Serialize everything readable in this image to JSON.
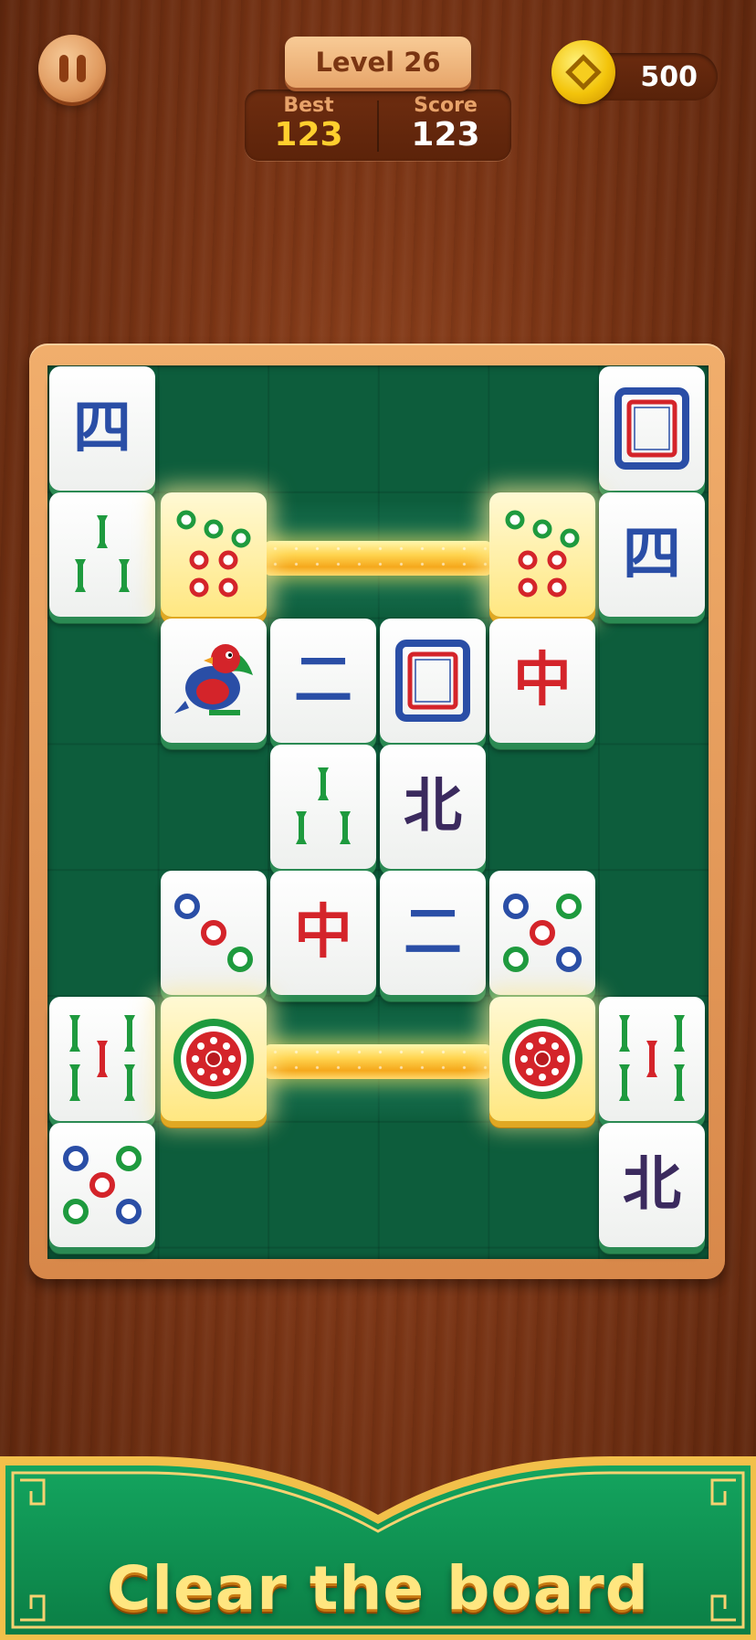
{
  "hud": {
    "pause_icon": "pause-icon",
    "level_label": "Level 26",
    "best_label": "Best",
    "best_value": "123",
    "score_label": "Score",
    "score_value": "123",
    "coin_icon": "coin-icon",
    "coins": "500"
  },
  "board": {
    "tiles": [
      {
        "id": "t0",
        "label": "四",
        "kind": "character-four"
      },
      {
        "id": "t1",
        "label": "",
        "kind": "white-dragon"
      },
      {
        "id": "t2",
        "label": "",
        "kind": "bamboo-three"
      },
      {
        "id": "t3",
        "label": "",
        "kind": "circles-eight",
        "highlighted": true
      },
      {
        "id": "t4",
        "label": "",
        "kind": "circles-eight",
        "highlighted": true
      },
      {
        "id": "t5",
        "label": "四",
        "kind": "character-four"
      },
      {
        "id": "t6",
        "label": "",
        "kind": "bird-bamboo-one"
      },
      {
        "id": "t7",
        "label": "二",
        "kind": "character-two"
      },
      {
        "id": "t8",
        "label": "",
        "kind": "white-dragon"
      },
      {
        "id": "t9",
        "label": "中",
        "kind": "red-dragon"
      },
      {
        "id": "t10",
        "label": "",
        "kind": "bamboo-three"
      },
      {
        "id": "t11",
        "label": "北",
        "kind": "north-wind"
      },
      {
        "id": "t12",
        "label": "",
        "kind": "circles-three"
      },
      {
        "id": "t13",
        "label": "中",
        "kind": "red-dragon"
      },
      {
        "id": "t14",
        "label": "二",
        "kind": "character-two"
      },
      {
        "id": "t15",
        "label": "",
        "kind": "circles-five"
      },
      {
        "id": "t16",
        "label": "",
        "kind": "bamboo-five"
      },
      {
        "id": "t17",
        "label": "",
        "kind": "circles-one-flower",
        "highlighted": true
      },
      {
        "id": "t18",
        "label": "",
        "kind": "circles-one-flower",
        "highlighted": true
      },
      {
        "id": "t19",
        "label": "",
        "kind": "bamboo-five"
      },
      {
        "id": "t20",
        "label": "",
        "kind": "circles-five"
      },
      {
        "id": "t21",
        "label": "北",
        "kind": "north-wind"
      }
    ]
  },
  "banner": {
    "text": "Clear the board"
  },
  "colors": {
    "felt": "#0d5d3c",
    "frame": "#e69a5a",
    "best_value": "#ffcf2e",
    "score_value": "#ffffff",
    "tile_blue": "#2a4ea6",
    "tile_red": "#d4242a",
    "tile_green": "#1e9a3e",
    "tile_purple": "#3b2a5e"
  }
}
